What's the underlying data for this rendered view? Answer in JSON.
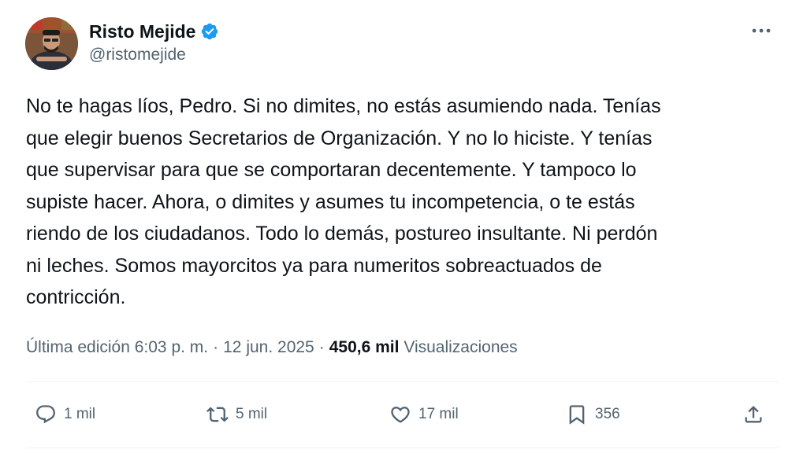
{
  "author": {
    "display_name": "Risto Mejide",
    "handle": "@ristomejide",
    "verified": true,
    "verified_color": "#1d9bf0"
  },
  "tweet": {
    "text": "No te hagas líos, Pedro. Si no dimites, no estás asumiendo nada. Tenías\nque elegir buenos Secretarios de Organización. Y no lo hiciste. Y tenías\nque supervisar para que se comportaran decentemente. Y tampoco lo\nsupiste hacer. Ahora, o dimites y asumes tu incompetencia, o te estás\nriendo de los ciudadanos. Todo lo demás, postureo insultante. Ni perdón\nni leches. Somos mayorcitos ya para numeritos sobreactuados de\ncontricción."
  },
  "meta": {
    "edited_label": "Última edición",
    "time": "6:03 p. m.",
    "separator": "·",
    "date": "12 jun. 2025",
    "views_count": "450,6 mil",
    "views_label": "Visualizaciones"
  },
  "actions": {
    "reply": {
      "icon": "reply-icon",
      "count": "1 mil"
    },
    "retweet": {
      "icon": "retweet-icon",
      "count": "5 mil"
    },
    "like": {
      "icon": "heart-icon",
      "count": "17 mil"
    },
    "bookmark": {
      "icon": "bookmark-icon",
      "count": "356"
    },
    "share": {
      "icon": "share-icon"
    }
  },
  "icons": {
    "more": "more-dots-icon"
  }
}
